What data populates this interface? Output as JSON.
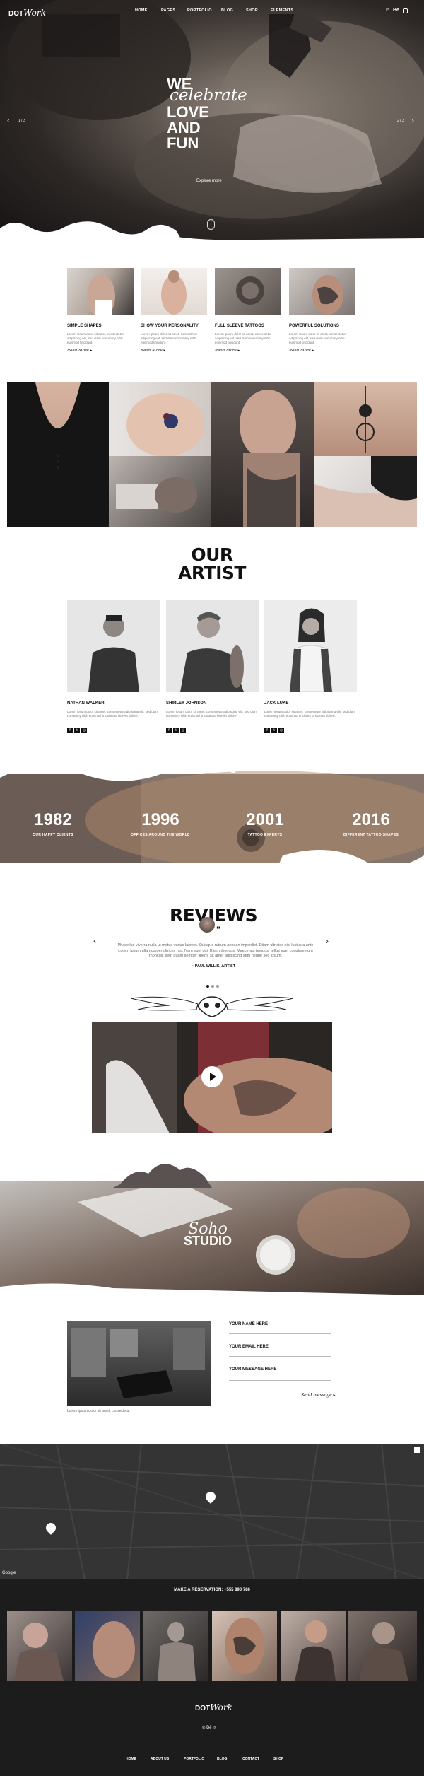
{
  "brand": {
    "dot": "DOT",
    "work": "Work"
  },
  "nav": [
    "HOME",
    "PAGES",
    "PORTFOLIO",
    "BLOG",
    "SHOP",
    "ELEMENTS"
  ],
  "nav_icons": [
    "pinterest-icon",
    "behance-icon",
    "instagram-icon"
  ],
  "hero": {
    "line1": "WE",
    "line2": "celebrate",
    "line3": "LOVE",
    "line4": "AND",
    "line5": "FUN",
    "cta": "Explore more",
    "pager_left": "1 / 3",
    "pager_right": "2 / 3"
  },
  "features": [
    {
      "title": "SIMPLE SHAPES",
      "desc": "Lorem ipsum dolor sit amet, consectetur adipiscing elit, sed diam nonummy nibh euismod tincidunt.",
      "more": "Read More"
    },
    {
      "title": "SHOW YOUR PERSONALITY",
      "desc": "Lorem ipsum dolor sit amet, consectetur adipiscing elit, sed diam nonummy nibh euismod tincidunt.",
      "more": "Read More"
    },
    {
      "title": "FULL SLEEVE TATTOOS",
      "desc": "Lorem ipsum dolor sit amet, consectetur adipiscing elit, sed diam nonummy nibh euismod tincidunt.",
      "more": "Read More"
    },
    {
      "title": "POWERFUL SOLUTIONS",
      "desc": "Lorem ipsum dolor sit amet, consectetur adipiscing elit, sed diam nonummy nibh euismod tincidunt.",
      "more": "Read More"
    }
  ],
  "artists_section": {
    "line1": "OUR",
    "line2": "ARTIST"
  },
  "artists": [
    {
      "name": "NATHAN WALKER",
      "desc": "Lorem ipsum dolor sit amet, consectetur adipiscing elit, sed diam nonummy nibh euismod tincidunt ut laoreet dolore."
    },
    {
      "name": "SHIRLEY JOHNSON",
      "desc": "Lorem ipsum dolor sit amet, consectetur adipiscing elit, sed diam nonummy nibh euismod tincidunt ut laoreet dolore."
    },
    {
      "name": "JACK LUKE",
      "desc": "Lorem ipsum dolor sit amet, consectetur adipiscing elit, sed diam nonummy nibh euismod tincidunt ut laoreet dolore."
    }
  ],
  "stats": [
    {
      "value": "1982",
      "label": "OUR HAPPY CLIENTS"
    },
    {
      "value": "1996",
      "label": "OFFICES AROUND THE WORLD"
    },
    {
      "value": "2001",
      "label": "TATTOO EXPERTS"
    },
    {
      "value": "2016",
      "label": "DIFFERENT TATTOO SHAPES"
    }
  ],
  "reviews": {
    "title": "REVIEWS",
    "quote": "Phasellus viverra nulla ut metus varius laoreet. Quisque rutrum aenean imperdiet. Etiam ultricies nisi luctus a ante Lorem ipsum ullamcorper ultrices nisi. Nam eget dui. Etiam rhoncus. Maecenas tempus, tellus eget condimentum rhoncus, sem quam semper libero, sit amet adipiscing sem neque sed ipsum.",
    "author": "~ PAUL WILLIS, ARTIST"
  },
  "soho": {
    "script": "Soho",
    "block": "STUDIO"
  },
  "contact": {
    "caption": "Lorem ipsum dolor sit amet, consectetu.",
    "name_label": "YOUR NAME HERE",
    "email_label": "YOUR EMAIL HERE",
    "message_label": "YOUR MESSAGE HERE",
    "send": "Send message"
  },
  "map": {
    "brand": "Google"
  },
  "reservation": "MAKE A RESERVATION: +555 890 786",
  "footer_nav": [
    "HOME",
    "ABOUT US",
    "PORTFOLIO",
    "BLOG",
    "CONTACT",
    "SHOP"
  ],
  "colors": {
    "dark": "#1c1c1c",
    "map": "#343434",
    "text": "#111111",
    "muted": "#777777"
  }
}
